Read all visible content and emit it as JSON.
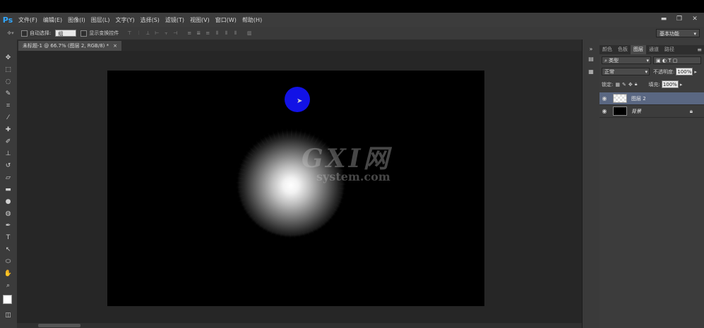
{
  "menubar": {
    "logo": "Ps",
    "items": [
      "文件(F)",
      "编辑(E)",
      "图像(I)",
      "图层(L)",
      "文字(Y)",
      "选择(S)",
      "滤镜(T)",
      "视图(V)",
      "窗口(W)",
      "帮助(H)"
    ],
    "window_controls": [
      "▬",
      "❐",
      "✕"
    ]
  },
  "options": {
    "auto_select_label": "自动选择:",
    "auto_select_value": "组",
    "show_transform_label": "显示变换控件",
    "workspace": "基本功能"
  },
  "document": {
    "tab_label": "未标题-1 @ 66.7% (图层 2, RGB/8) *",
    "close": "×"
  },
  "watermark": {
    "main": "GXI网",
    "sub": "system.com"
  },
  "right_panel": {
    "tabs": [
      "颜色",
      "色板",
      "图层",
      "通道",
      "路径"
    ],
    "active_tab": "图层",
    "kind_filter": "类型",
    "blend_mode": "正常",
    "opacity_label": "不透明度:",
    "opacity_value": "100%",
    "lock_label": "锁定:",
    "fill_label": "填充:",
    "fill_value": "100%",
    "layers": [
      {
        "name": "图层 2",
        "selected": true,
        "thumb": "transparent"
      },
      {
        "name": "背景",
        "selected": false,
        "thumb": "black",
        "locked": true
      }
    ]
  },
  "colors": {
    "ps_blue": "#31a8ff",
    "cursor_blue": "#1212e6",
    "canvas": "#000000",
    "selected_layer": "#5a6782"
  }
}
